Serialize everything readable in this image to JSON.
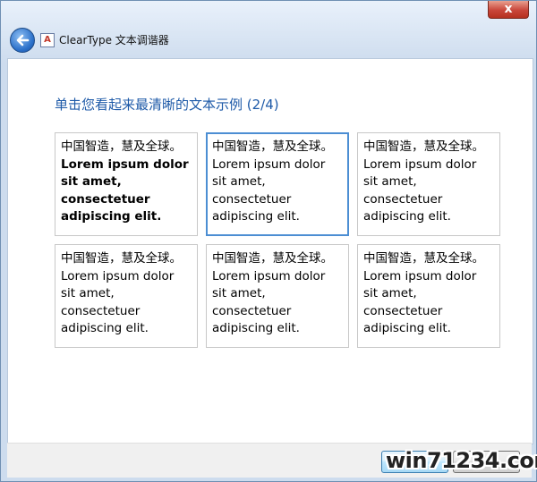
{
  "window": {
    "close_label": "x",
    "app_icon_glyph": "A",
    "title": "ClearType 文本调谐器"
  },
  "main": {
    "heading": "单击您看起来最清晰的文本示例 (2/4)",
    "samples": [
      {
        "cn": "中国智造，慧及全球。",
        "en": "Lorem ipsum dolor\nsit amet,\nconsectetuer\nadipiscing elit.",
        "selected": false
      },
      {
        "cn": "中国智造，慧及全球。",
        "en": "Lorem ipsum dolor\nsit amet,\nconsectetuer\nadipiscing elit.",
        "selected": true
      },
      {
        "cn": "中国智造，慧及全球。",
        "en": "Lorem ipsum dolor\nsit amet,\nconsectetuer\nadipiscing elit.",
        "selected": false
      },
      {
        "cn": "中国智造，慧及全球。",
        "en": "Lorem ipsum dolor\nsit amet,\nconsectetuer\nadipiscing elit.",
        "selected": false
      },
      {
        "cn": "中国智造，慧及全球。",
        "en": "Lorem ipsum dolor\nsit amet,\nconsectetuer\nadipiscing elit.",
        "selected": false
      },
      {
        "cn": "中国智造，慧及全球。",
        "en": "Lorem ipsum dolor\nsit amet,\nconsectetuer\nadipiscing elit.",
        "selected": false
      }
    ]
  },
  "footer": {
    "watermark": "win71234.com"
  },
  "colors": {
    "heading": "#1e5aa8",
    "selected_border": "#4c8ed3",
    "close_button": "#c9463a"
  }
}
